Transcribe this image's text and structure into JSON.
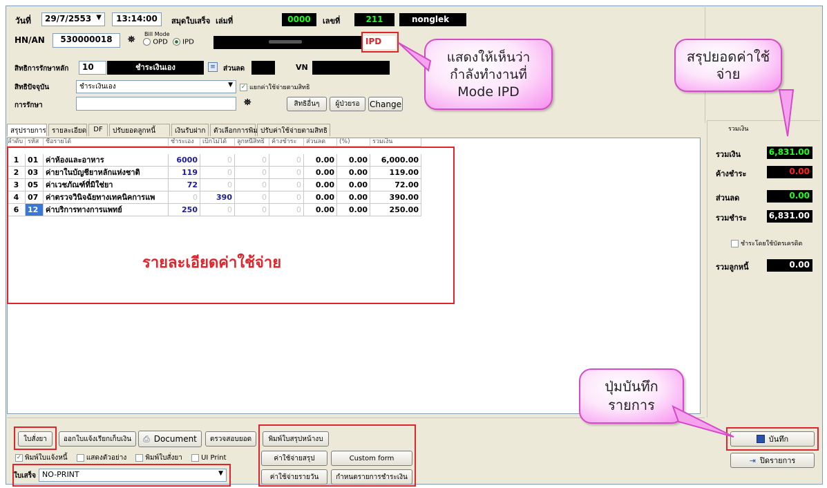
{
  "header": {
    "date_label": "วันที่",
    "date_value": "29/7/2553",
    "time_value": "13:14:00",
    "book_label": "สมุดใบเสร็จ",
    "book_no_label": "เล่มที่",
    "book_no": "0000",
    "number_label": "เลขที่",
    "number": "211",
    "user": "nonglek",
    "hn_label": "HN/AN",
    "hn_value": "530000018",
    "bill_mode_label": "Bill Mode",
    "opd_label": "OPD",
    "ipd_label": "IPD",
    "mode_indicator": "IPD",
    "main_right_label": "สิทธิการรักษาหลัก",
    "main_right_code": "10",
    "main_right_name": "ชำระเงินเอง",
    "discount_label": "ส่วนลด",
    "vn_label": "VN",
    "current_right_label": "สิทธิปัจจุบัน",
    "current_right_value": "ชำระเงินเอง",
    "split_label": "แยกค่าใช้จ่ายตามสิทธิ",
    "treatment_label": "การรักษา",
    "other_rights_button": "สิทธิอื่นๆ",
    "guarantor_button": "ผู้ป่วยรอ",
    "change_button": "Change"
  },
  "tabs": [
    "สรุปรายการ",
    "รายละเอียด",
    "DF",
    "ปรับยอดลูกหนี้",
    "เงินรับฝาก",
    "ตัวเลือกการพิมพ์",
    "ปรับค่าใช้จ่ายตามสิทธิ"
  ],
  "table": {
    "headers": [
      "ลำดับ",
      "รหัส",
      "ชื่อรายได้",
      "ชำระเอง",
      "เบิกไม่ได้",
      "ลูกหนี้สิทธิ",
      "ค้างชำระ",
      "ส่วนลด",
      "(%)",
      "รวมเงิน"
    ],
    "rows": [
      [
        "1",
        "01",
        "ค่าห้องและอาหาร",
        "6000",
        "0",
        "0",
        "0",
        "0.00",
        "0.00",
        "6,000.00"
      ],
      [
        "2",
        "03",
        "ค่ายาในบัญชียาหลักแห่งชาติ",
        "119",
        "0",
        "0",
        "0",
        "0.00",
        "0.00",
        "119.00"
      ],
      [
        "3",
        "05",
        "ค่าเวชภัณฑ์ที่มิใช่ยา",
        "72",
        "0",
        "0",
        "0",
        "0.00",
        "0.00",
        "72.00"
      ],
      [
        "4",
        "07",
        "ค่าตรวจวินิจฉัยทางเทคนิคการแพ",
        "0",
        "390",
        "0",
        "0",
        "0.00",
        "0.00",
        "390.00"
      ],
      [
        "6",
        "12",
        "ค่าบริการทางการแพทย์",
        "250",
        "0",
        "0",
        "0",
        "0.00",
        "0.00",
        "250.00"
      ]
    ]
  },
  "annotation_expense": "รายละเอียดค่าใช้จ่าย",
  "summary": {
    "header": "รวมเงิน",
    "total_label": "รวมเงิน",
    "total_value": "6,831.00",
    "outstanding_label": "ค้างชำระ",
    "outstanding_value": "0.00",
    "discount_label": "ส่วนลด",
    "discount_value": "0.00",
    "payable_label": "รวมชำระ",
    "payable_value": "6,831.00",
    "credit_card_label": "ชำระโดยใช้บัตรเครดิต",
    "debtor_label": "รวมลูกหนี้",
    "debtor_value": "0.00"
  },
  "bottom": {
    "prescription_button": "ใบสั่งยา",
    "collection_button": "ออกใบแจ้งเรียกเก็บเงิน",
    "document_button": "Document",
    "check_balance_button": "ตรวจสอบยอด",
    "print_summary_button": "พิมพ์ใบสรุปหน้างบ",
    "expense_summary_button": "ค่าใช้จ่ายสรุป",
    "custom_form_button": "Custom form",
    "daily_expense_button": "ค่าใช้จ่ายรายวัน",
    "define_payment_button": "กำหนดรายการชำระเงิน",
    "print_debt_check": "พิมพ์ใบแจ้งหนี้",
    "show_sample_check": "แสดงตัวอย่าง",
    "print_prescription_check": "พิมพ์ใบสั่งยา",
    "ui_print_check": "UI Print",
    "receipt_label": "ใบเสร็จ",
    "receipt_value": "NO-PRINT",
    "save_button": "บันทึก",
    "close_button": "ปิดรายการ"
  },
  "callouts": {
    "mode": [
      "แสดงให้เห็นว่า",
      "กำลังทำงานที่",
      "Mode IPD"
    ],
    "summary": [
      "สรุปยอดค่าใช้",
      "จ่าย"
    ],
    "save": [
      "ปุ่มบันทึก",
      "รายการ"
    ]
  },
  "colors": {
    "highlight_red": "#e0242a",
    "callout_pink": "#f78ef0",
    "value_green": "#1cff1c",
    "value_red": "#ff2020"
  }
}
